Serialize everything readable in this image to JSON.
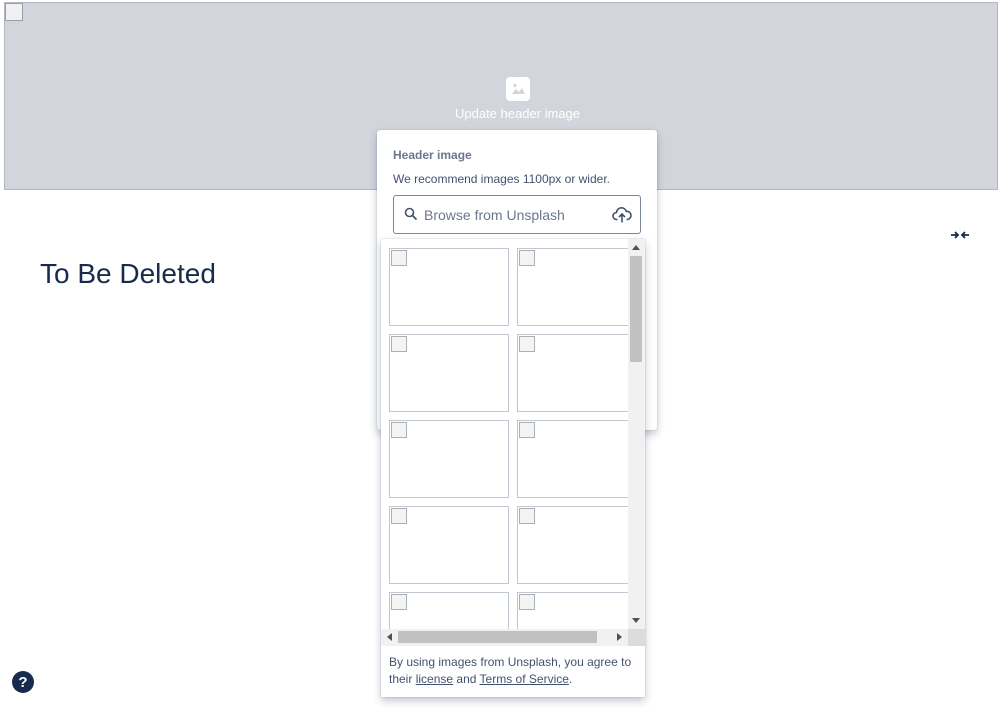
{
  "header": {
    "update_label": "Update header image",
    "update_icon": "image-icon",
    "broken_image_icon": "broken-image-icon"
  },
  "page": {
    "title": "To Be Deleted",
    "collapse_icon": "collapse-width-icon"
  },
  "popup": {
    "title": "Header image",
    "description": "We recommend images 1100px or wider.",
    "search": {
      "placeholder": "Browse from Unsplash",
      "value": "",
      "icon": "search-icon",
      "upload_icon": "upload-cloud-icon"
    }
  },
  "gallery": {
    "thumbnails": [
      {
        "icon": "broken-image-icon"
      },
      {
        "icon": "broken-image-icon"
      },
      {
        "icon": "broken-image-icon"
      },
      {
        "icon": "broken-image-icon"
      },
      {
        "icon": "broken-image-icon"
      },
      {
        "icon": "broken-image-icon"
      },
      {
        "icon": "broken-image-icon"
      },
      {
        "icon": "broken-image-icon"
      },
      {
        "icon": "broken-image-icon"
      },
      {
        "icon": "broken-image-icon"
      }
    ],
    "attribution": {
      "prefix": "By using images from Unsplash, you agree to their",
      "license_link": "license",
      "and": "and",
      "terms_link": "Terms of Service",
      "suffix": "."
    }
  },
  "help": {
    "label": "?",
    "icon": "help-icon"
  },
  "colors": {
    "banner": "#d2d5db",
    "text": "#172b4d",
    "muted": "#6b778c",
    "help_bg": "#172b4d"
  }
}
